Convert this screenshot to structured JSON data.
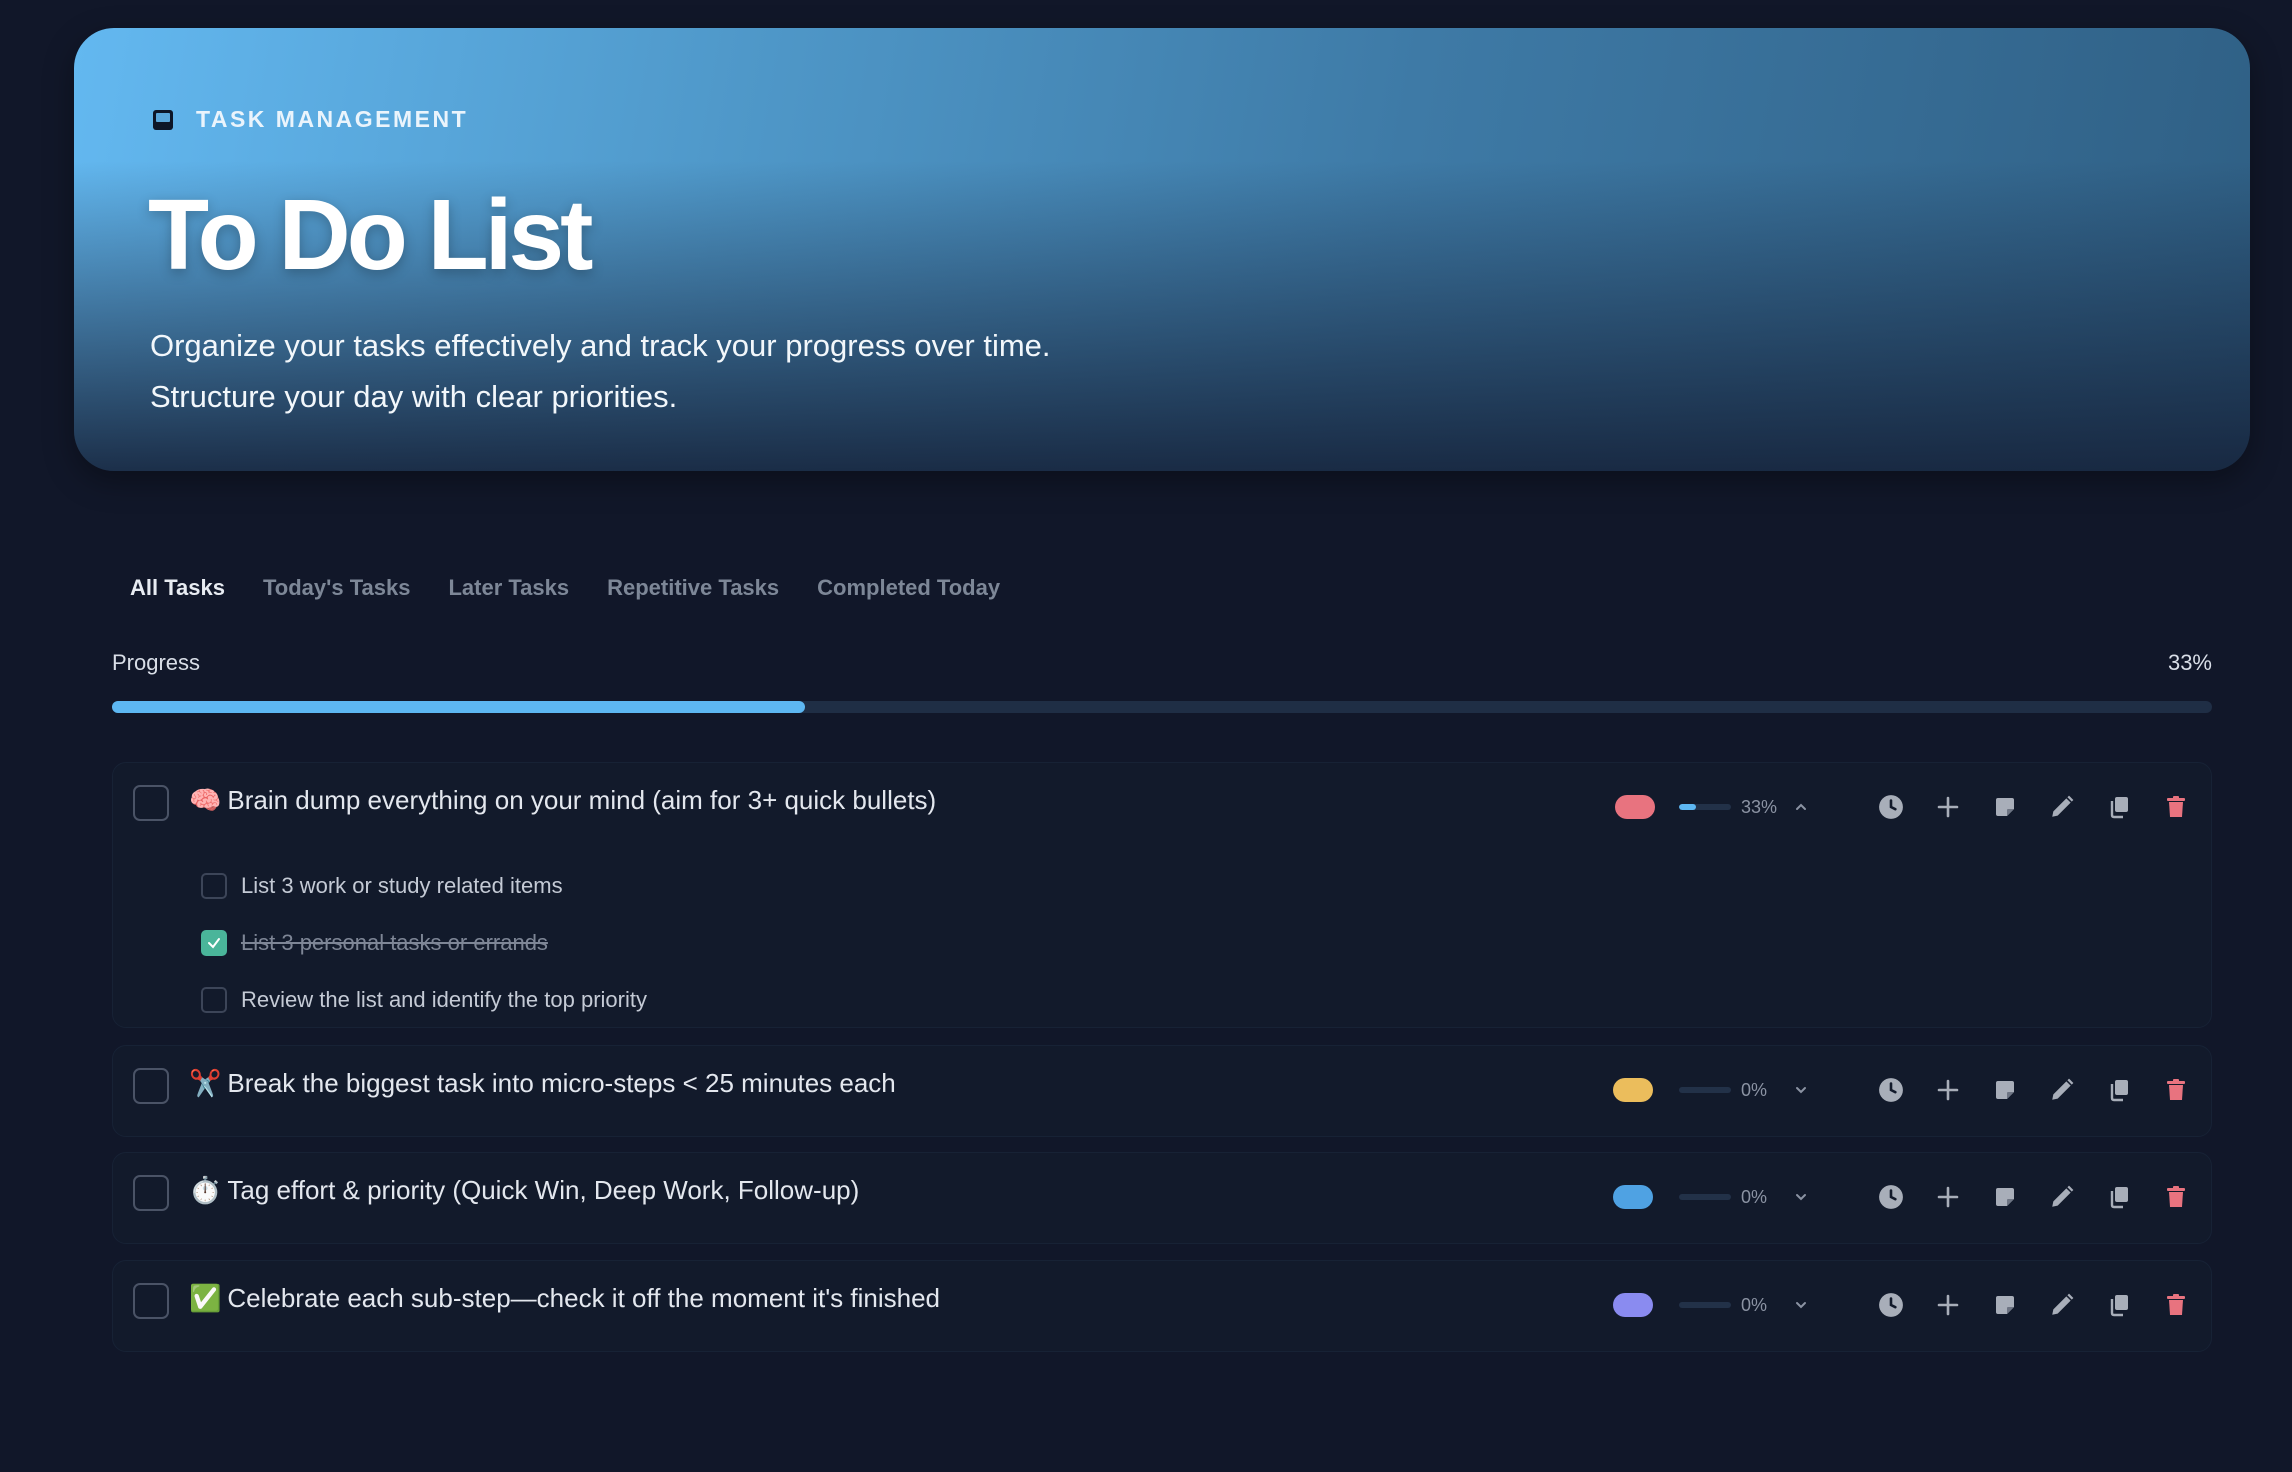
{
  "header": {
    "eyebrow": "TASK MANAGEMENT",
    "title": "To Do List",
    "desc_line1": "Organize your tasks effectively and track your progress over time.",
    "desc_line2": "Structure your day with clear priorities."
  },
  "tabs": [
    {
      "label": "All Tasks",
      "active": true
    },
    {
      "label": "Today's Tasks",
      "active": false
    },
    {
      "label": "Later Tasks",
      "active": false
    },
    {
      "label": "Repetitive Tasks",
      "active": false
    },
    {
      "label": "Completed Today",
      "active": false
    }
  ],
  "progress": {
    "label": "Progress",
    "percent_text": "33%",
    "value": 0.33
  },
  "tasks": [
    {
      "emoji": "🧠",
      "title": "Brain dump everything on your mind (aim for 3+ quick bullets)",
      "tag_color": "#e8737f",
      "progress_value": 0.33,
      "progress_text": "33%",
      "expanded": true,
      "subtasks": [
        {
          "text": "List 3 work or study related items",
          "done": false
        },
        {
          "text": "List 3 personal tasks or errands",
          "done": true
        },
        {
          "text": "Review the list and identify the top priority",
          "done": false
        }
      ]
    },
    {
      "emoji": "✂️",
      "title": "Break the biggest task into micro-steps < 25 minutes each",
      "tag_color": "#ebbd5c",
      "progress_value": 0,
      "progress_text": "0%",
      "expanded": false
    },
    {
      "emoji": "⏱️",
      "title": "Tag effort & priority (Quick Win, Deep Work, Follow-up)",
      "tag_color": "#4fa2e3",
      "progress_value": 0,
      "progress_text": "0%",
      "expanded": false
    },
    {
      "emoji": "✅",
      "title": "Celebrate each sub-step—check it off the moment it's finished",
      "tag_color": "#8a8bf0",
      "progress_value": 0,
      "progress_text": "0%",
      "expanded": false
    }
  ],
  "icons": {
    "header": "inbox-icon",
    "actions": [
      "clock-icon",
      "plus-icon",
      "note-icon",
      "pencil-icon",
      "copy-icon",
      "trash-icon"
    ],
    "expanded": "chevron-up-icon",
    "collapsed": "chevron-down-icon"
  },
  "colors": {
    "accent": "#5db7f2",
    "delete": "#e8737f",
    "check": "#4ab59a",
    "background": "#111729"
  }
}
